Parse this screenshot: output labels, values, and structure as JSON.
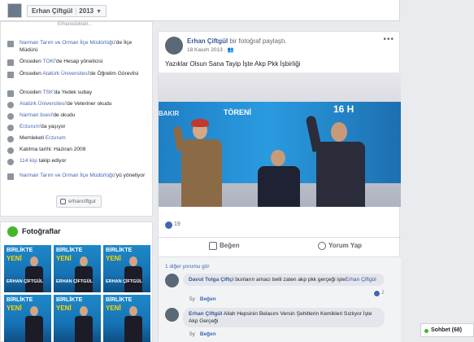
{
  "topbar": {
    "name": "Erhan Çiftgül",
    "year": "2013"
  },
  "intro": {
    "cut_text": "Erhanoduklari...",
    "items": [
      {
        "pre": "",
        "link": "Narman Tarım ve Orman İlçe Müdürlüğü",
        "post": "'de İlçe Müdürü"
      },
      {
        "pre": "Önceden ",
        "link": "TOKİ",
        "post": "'de Hesap yöneticisi"
      },
      {
        "pre": "Önceden ",
        "link": "Atatürk Üniversitesi",
        "post": "'de Öğretim Görevlisi"
      },
      {
        "pre": "Önceden ",
        "link": "TSK",
        "post": "'da Yedek subay"
      },
      {
        "pre": "",
        "link": "Atatürk Üniversitesi",
        "post": "'de Veteriner okudu"
      },
      {
        "pre": "",
        "link": "Narman lisesi",
        "post": "'de okudu"
      },
      {
        "pre": "",
        "link": "Erzurum",
        "post": "'da yaşıyor"
      },
      {
        "pre": "Memleketi ",
        "link": "Erzurum",
        "post": ""
      },
      {
        "pre": "Katılma tarihi: Haziran 2008",
        "link": "",
        "post": ""
      },
      {
        "pre": "",
        "link": "114 kişi",
        "post": " takip ediyor"
      },
      {
        "pre": "",
        "link": "Narman Tarım ve Orman İlçe Müdürlüğü",
        "post": "'yü yönetiyor"
      }
    ],
    "instagram": "erhanciftgul"
  },
  "photos": {
    "title": "Fotoğraflar",
    "thumb_line1": "BİRLİKTE",
    "thumb_line2": "YENİ",
    "thumb_name": "ERHAN ÇİFTGÜL"
  },
  "post": {
    "author": "Erhan Çiftgül",
    "action": " bir fotoğraf paylaştı.",
    "date": "18 Kasım 2013",
    "more": "•••",
    "caption": "Yazıklar Olsun Sana Tayip İşte Akp Pkk İşbirliği",
    "photo_texts": {
      "left": "BAKIR",
      "center": "TÖRENİ",
      "right": "16 H"
    },
    "likes": "19",
    "like_label": "Beğen",
    "comment_label": "Yorum Yap",
    "more_comments": "1 diğer yorumu gör",
    "comments": [
      {
        "name": "Davut Tolga Çiftçi",
        "text": " bunların amacı belli zaten akp pkk gerçeği işte",
        "tag": "Erhan Çiftgül",
        "age": "5y",
        "like": "Beğen",
        "reacts": "2"
      },
      {
        "name": "Erhan Çiftgül",
        "text": " Allah Hepsinin Belasını Versin Şehitlerin Kemikleri Sızlıyor İşte Akp Gerçeği",
        "tag": "",
        "age": "5y",
        "like": "Beğen",
        "reacts": ""
      }
    ]
  },
  "chat": {
    "label": "Sohbet (68)"
  }
}
